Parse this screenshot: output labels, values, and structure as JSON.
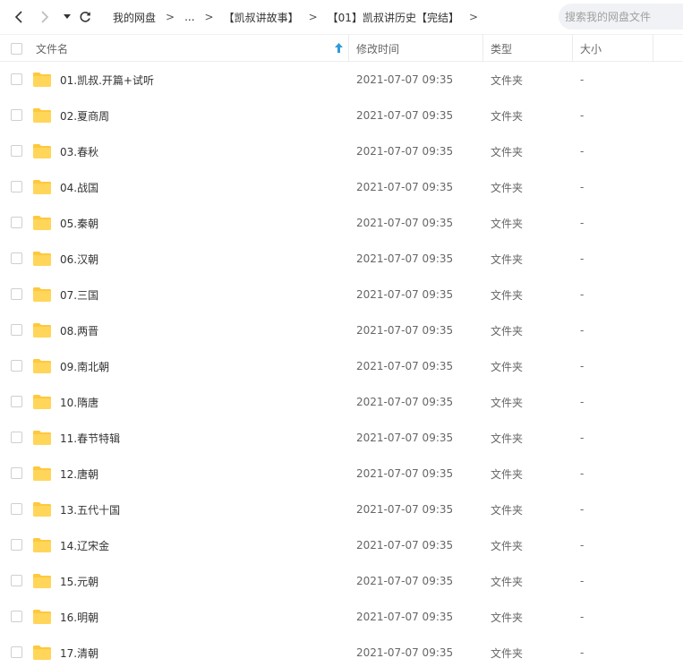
{
  "toolbar": {
    "breadcrumb": [
      {
        "label": "我的网盘"
      },
      {
        "label": "..."
      },
      {
        "label": "【凯叔讲故事】"
      },
      {
        "label": "【01】凯叔讲历史【完结】"
      }
    ],
    "separator": ">",
    "search_placeholder": "搜索我的网盘文件"
  },
  "table": {
    "columns": {
      "name": "文件名",
      "modified": "修改时间",
      "type": "类型",
      "size": "大小"
    },
    "sort_column": "name",
    "sort_direction": "asc",
    "rows": [
      {
        "name": "01.凯叔.开篇+试听",
        "modified": "2021-07-07 09:35",
        "type": "文件夹",
        "size": "-"
      },
      {
        "name": "02.夏商周",
        "modified": "2021-07-07 09:35",
        "type": "文件夹",
        "size": "-"
      },
      {
        "name": "03.春秋",
        "modified": "2021-07-07 09:35",
        "type": "文件夹",
        "size": "-"
      },
      {
        "name": "04.战国",
        "modified": "2021-07-07 09:35",
        "type": "文件夹",
        "size": "-"
      },
      {
        "name": "05.秦朝",
        "modified": "2021-07-07 09:35",
        "type": "文件夹",
        "size": "-"
      },
      {
        "name": "06.汉朝",
        "modified": "2021-07-07 09:35",
        "type": "文件夹",
        "size": "-"
      },
      {
        "name": "07.三国",
        "modified": "2021-07-07 09:35",
        "type": "文件夹",
        "size": "-"
      },
      {
        "name": "08.两晋",
        "modified": "2021-07-07 09:35",
        "type": "文件夹",
        "size": "-"
      },
      {
        "name": "09.南北朝",
        "modified": "2021-07-07 09:35",
        "type": "文件夹",
        "size": "-"
      },
      {
        "name": "10.隋唐",
        "modified": "2021-07-07 09:35",
        "type": "文件夹",
        "size": "-"
      },
      {
        "name": "11.春节特辑",
        "modified": "2021-07-07 09:35",
        "type": "文件夹",
        "size": "-"
      },
      {
        "name": "12.唐朝",
        "modified": "2021-07-07 09:35",
        "type": "文件夹",
        "size": "-"
      },
      {
        "name": "13.五代十国",
        "modified": "2021-07-07 09:35",
        "type": "文件夹",
        "size": "-"
      },
      {
        "name": "14.辽宋金",
        "modified": "2021-07-07 09:35",
        "type": "文件夹",
        "size": "-"
      },
      {
        "name": "15.元朝",
        "modified": "2021-07-07 09:35",
        "type": "文件夹",
        "size": "-"
      },
      {
        "name": "16.明朝",
        "modified": "2021-07-07 09:35",
        "type": "文件夹",
        "size": "-"
      },
      {
        "name": "17.清朝",
        "modified": "2021-07-07 09:35",
        "type": "文件夹",
        "size": "-"
      }
    ]
  },
  "colors": {
    "folder": "#ffd65a",
    "folder_tab": "#ffc83d",
    "sort_arrow": "#2e9bd8",
    "row_divider": "#f3f3f3"
  },
  "icons": {
    "back": "chevron-left-icon",
    "forward": "chevron-right-icon",
    "history": "caret-down-icon",
    "refresh": "refresh-icon",
    "sort": "sort-up-icon",
    "folder": "folder-icon"
  }
}
